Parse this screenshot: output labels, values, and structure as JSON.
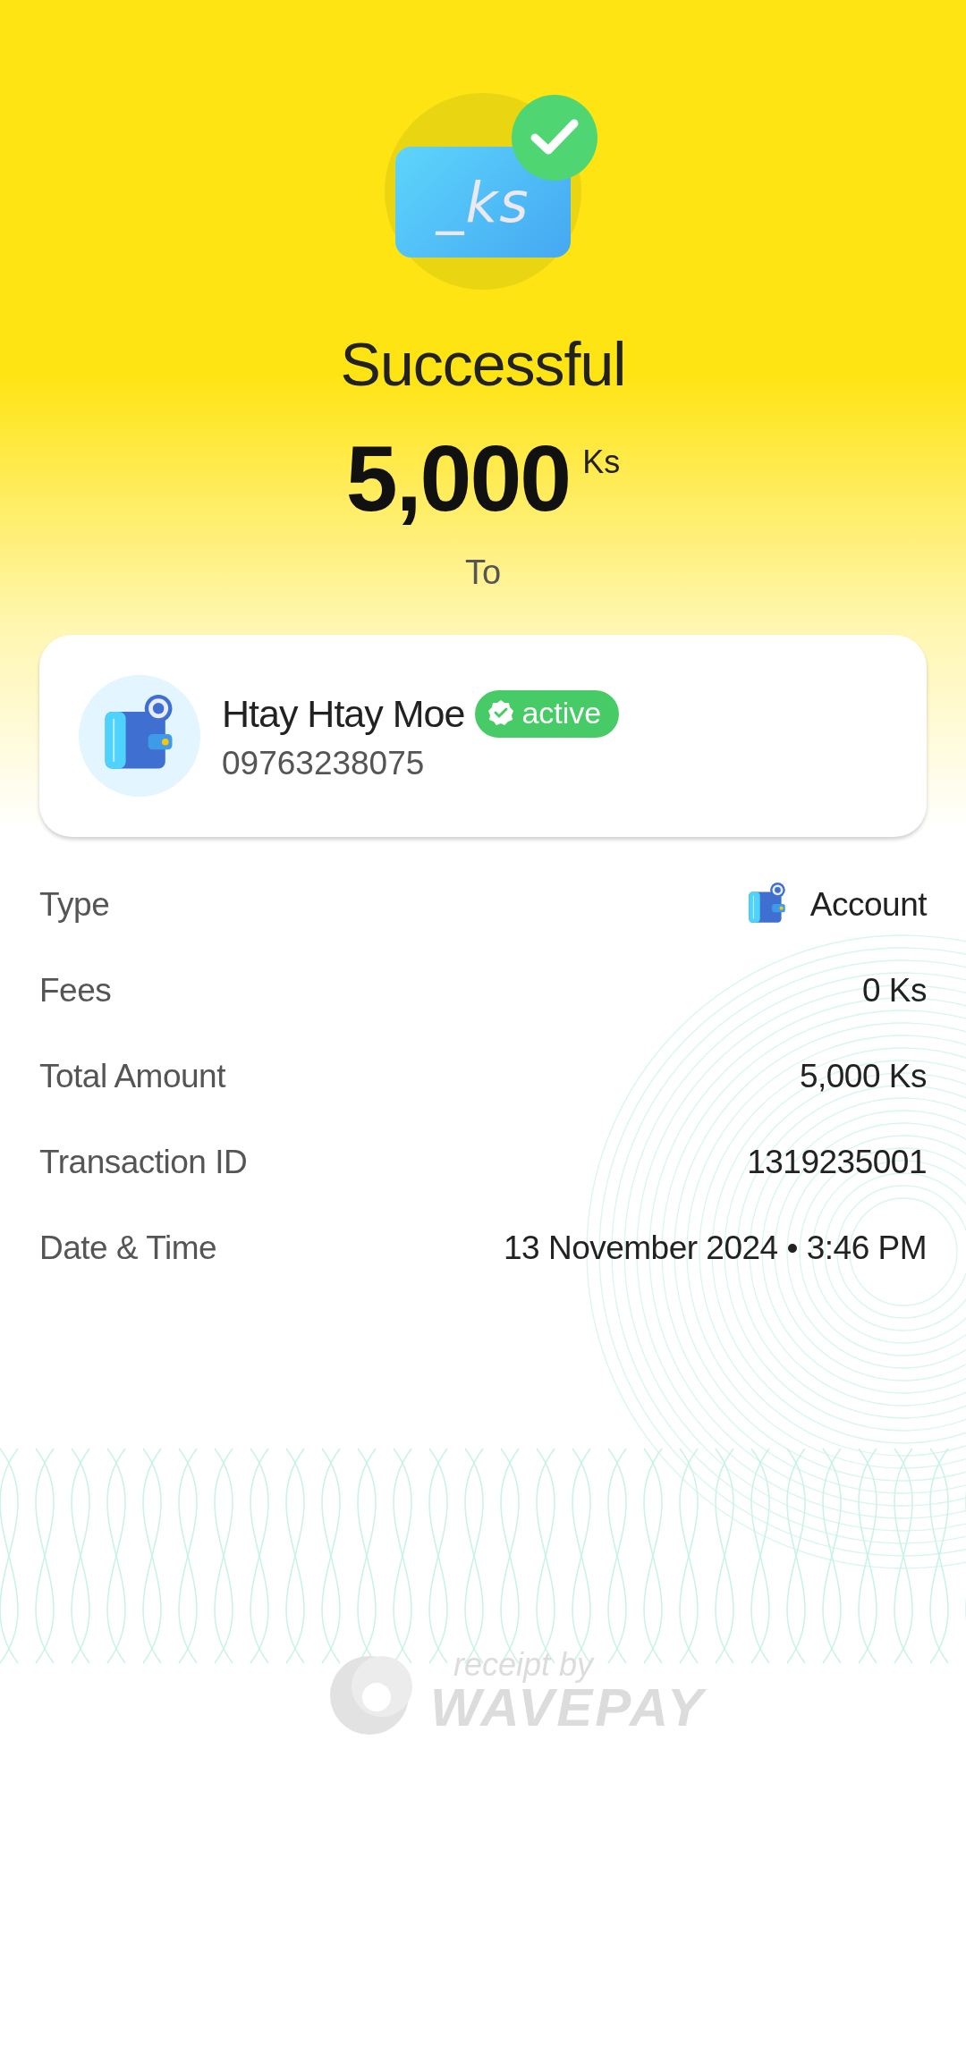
{
  "header": {
    "icon_text": "_ks",
    "title": "Successful",
    "amount": "5,000",
    "currency": "Ks",
    "to_label": "To"
  },
  "recipient": {
    "name": "Htay Htay Moe",
    "status": "active",
    "phone": "09763238075"
  },
  "details": [
    {
      "label": "Type",
      "value": "Account",
      "kind": "account"
    },
    {
      "label": "Fees",
      "value": "0 Ks",
      "kind": "text"
    },
    {
      "label": "Total Amount",
      "value": "5,000 Ks",
      "kind": "text"
    },
    {
      "label": "Transaction ID",
      "value": "1319235001",
      "kind": "text"
    },
    {
      "label": "Date & Time",
      "value": "13 November 2024 • 3:46 PM",
      "kind": "text"
    }
  ],
  "footer": {
    "line1": "receipt by",
    "line2": "WAVEPAY"
  }
}
